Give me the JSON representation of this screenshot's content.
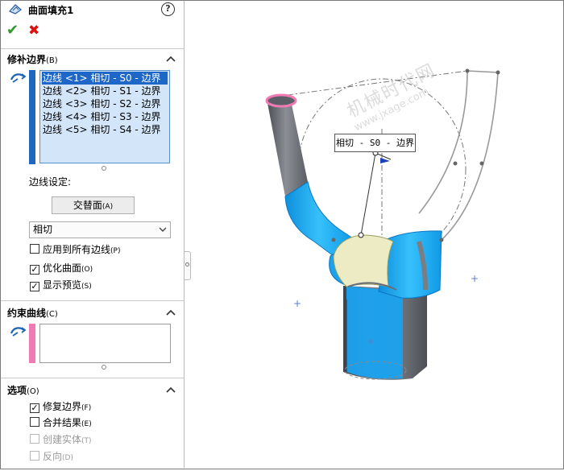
{
  "feature": {
    "title": "曲面填充1"
  },
  "actions": {
    "ok": "✔",
    "cancel": "✖",
    "help": "?"
  },
  "patch_boundary": {
    "title": "修补边界",
    "shortcut": "(B)",
    "edges": [
      "边线 <1> 相切 - S0 - 边界",
      "边线 <2> 相切 - S1 - 边界",
      "边线 <3> 相切 - S2 - 边界",
      "边线 <4> 相切 - S3 - 边界",
      "边线 <5> 相切 - S4 - 边界"
    ],
    "selected_index": 0,
    "edge_settings_label": "边线设定:",
    "alternate_face_button": "交替面",
    "alternate_face_shortcut": "(A)",
    "condition_value": "相切",
    "options": [
      {
        "label": "应用到所有边线",
        "key": "(P)",
        "checked": false
      },
      {
        "label": "优化曲面",
        "key": "(O)",
        "checked": true
      },
      {
        "label": "显示预览",
        "key": "(S)",
        "checked": true
      }
    ]
  },
  "constraint_curves": {
    "title": "约束曲线",
    "shortcut": "(C)"
  },
  "options_section": {
    "title": "选项",
    "shortcut": "(O)",
    "options": [
      {
        "label": "修复边界",
        "key": "(F)",
        "checked": true,
        "enabled": true
      },
      {
        "label": "合并结果",
        "key": "(E)",
        "checked": false,
        "enabled": true
      },
      {
        "label": "创建实体",
        "key": "(T)",
        "checked": false,
        "enabled": false
      },
      {
        "label": "反向",
        "key": "(D)",
        "checked": false,
        "enabled": false
      }
    ]
  },
  "viewport": {
    "callout_text": "相切 - S0 - 边界",
    "watermark_text": "机械时代网",
    "watermark_url": "www.jxage.com"
  },
  "colors": {
    "accent_blue": "#1e67c6",
    "surface_blue": "#18a9ee",
    "tube_gray": "#6e7178",
    "patch_yellow": "#ecebc4",
    "pink_strip": "#f07ab4"
  }
}
